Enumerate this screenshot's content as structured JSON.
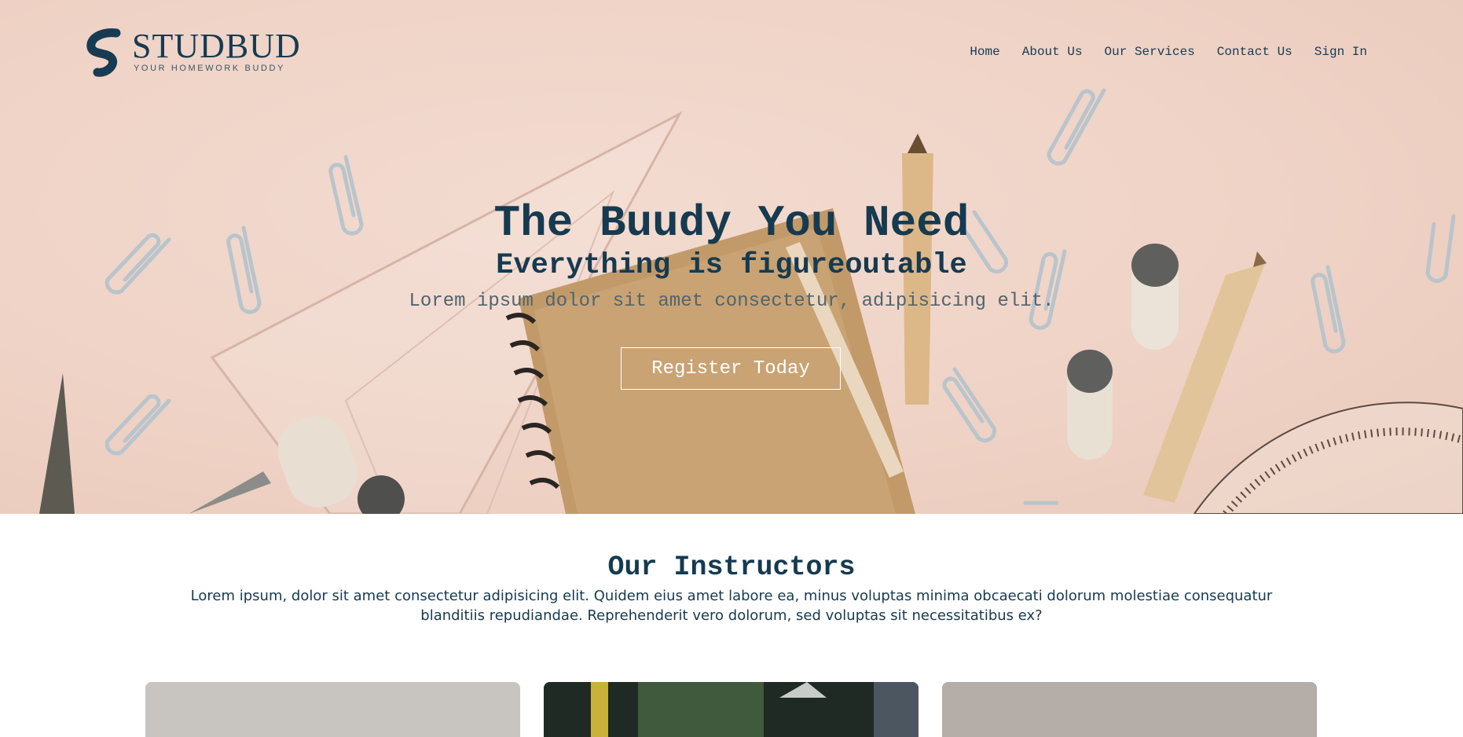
{
  "brand": {
    "name": "STUDBUD",
    "tagline": "YOUR HOMEWORK BUDDY"
  },
  "nav": {
    "items": [
      "Home",
      "About Us",
      "Our Services",
      "Contact Us",
      "Sign In"
    ]
  },
  "hero": {
    "title": "The Buudy You Need",
    "subtitle": "Everything is figureoutable",
    "description": "Lorem ipsum dolor sit amet consectetur, adipisicing elit.",
    "cta_label": "Register Today"
  },
  "instructors": {
    "title": "Our Instructors",
    "description": "Lorem ipsum, dolor sit amet consectetur adipisicing elit. Quidem eius amet labore ea, minus voluptas minima obcaecati dolorum molestiae consequatur blanditiis repudiandae. Reprehenderit vero dolorum, sed voluptas sit necessitatibus ex?"
  },
  "colors": {
    "primary": "#163a50",
    "hero_bg": "#efd3c6",
    "cta_border": "#ffffff"
  }
}
